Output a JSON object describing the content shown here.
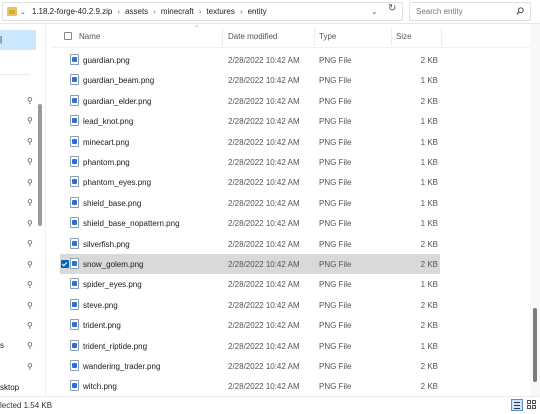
{
  "address_bar": {
    "crumbs": [
      "1.18.2-forge-40.2.9.zip",
      "assets",
      "minecraft",
      "textures",
      "entity"
    ],
    "search_placeholder": "Search entity"
  },
  "nav": {
    "labels": [
      "s",
      "sktop"
    ]
  },
  "columns": {
    "name": "Name",
    "date": "Date modified",
    "type": "Type",
    "size": "Size"
  },
  "files": [
    {
      "name": "guardian.png",
      "date": "2/28/2022 10:42 AM",
      "type": "PNG File",
      "size": "2 KB",
      "selected": false
    },
    {
      "name": "guardian_beam.png",
      "date": "2/28/2022 10:42 AM",
      "type": "PNG File",
      "size": "1 KB",
      "selected": false
    },
    {
      "name": "guardian_elder.png",
      "date": "2/28/2022 10:42 AM",
      "type": "PNG File",
      "size": "2 KB",
      "selected": false
    },
    {
      "name": "lead_knot.png",
      "date": "2/28/2022 10:42 AM",
      "type": "PNG File",
      "size": "1 KB",
      "selected": false
    },
    {
      "name": "minecart.png",
      "date": "2/28/2022 10:42 AM",
      "type": "PNG File",
      "size": "1 KB",
      "selected": false
    },
    {
      "name": "phantom.png",
      "date": "2/28/2022 10:42 AM",
      "type": "PNG File",
      "size": "1 KB",
      "selected": false
    },
    {
      "name": "phantom_eyes.png",
      "date": "2/28/2022 10:42 AM",
      "type": "PNG File",
      "size": "1 KB",
      "selected": false
    },
    {
      "name": "shield_base.png",
      "date": "2/28/2022 10:42 AM",
      "type": "PNG File",
      "size": "1 KB",
      "selected": false
    },
    {
      "name": "shield_base_nopattern.png",
      "date": "2/28/2022 10:42 AM",
      "type": "PNG File",
      "size": "1 KB",
      "selected": false
    },
    {
      "name": "silverfish.png",
      "date": "2/28/2022 10:42 AM",
      "type": "PNG File",
      "size": "2 KB",
      "selected": false
    },
    {
      "name": "snow_golem.png",
      "date": "2/28/2022 10:42 AM",
      "type": "PNG File",
      "size": "2 KB",
      "selected": true
    },
    {
      "name": "spider_eyes.png",
      "date": "2/28/2022 10:42 AM",
      "type": "PNG File",
      "size": "1 KB",
      "selected": false
    },
    {
      "name": "steve.png",
      "date": "2/28/2022 10:42 AM",
      "type": "PNG File",
      "size": "2 KB",
      "selected": false
    },
    {
      "name": "trident.png",
      "date": "2/28/2022 10:42 AM",
      "type": "PNG File",
      "size": "2 KB",
      "selected": false
    },
    {
      "name": "trident_riptide.png",
      "date": "2/28/2022 10:42 AM",
      "type": "PNG File",
      "size": "1 KB",
      "selected": false
    },
    {
      "name": "wandering_trader.png",
      "date": "2/28/2022 10:42 AM",
      "type": "PNG File",
      "size": "2 KB",
      "selected": false
    },
    {
      "name": "witch.png",
      "date": "2/28/2022 10:42 AM",
      "type": "PNG File",
      "size": "2 KB",
      "selected": false
    }
  ],
  "status_bar": {
    "text": "lected  1.54 KB"
  },
  "colors": {
    "selection": "#d9d9d9",
    "accent": "#0067c0",
    "nav_selection": "#cce8ff"
  }
}
